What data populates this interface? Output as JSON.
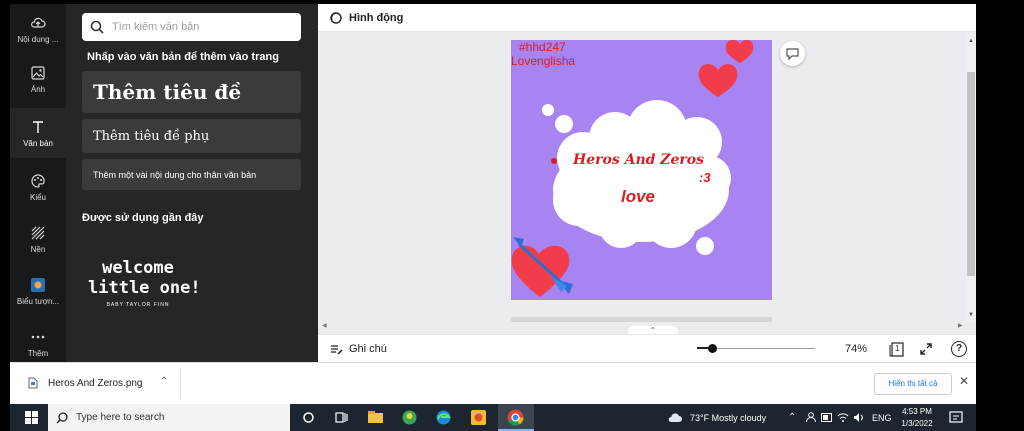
{
  "rail": {
    "items": [
      {
        "label": "Nội dung ...",
        "icon": "upload-cloud-icon"
      },
      {
        "label": "Ảnh",
        "icon": "photo-icon"
      },
      {
        "label": "Văn bản",
        "icon": "text-icon"
      },
      {
        "label": "Kiểu",
        "icon": "palette-icon"
      },
      {
        "label": "Nền",
        "icon": "background-pattern-icon"
      },
      {
        "label": "Biểu tượn...",
        "icon": "logo-icon"
      },
      {
        "label": "Thêm",
        "icon": "more-icon"
      }
    ]
  },
  "panel": {
    "search_placeholder": "Tìm kiếm văn bản",
    "add_text_heading": "Nhấp vào văn bản để thêm vào trang",
    "add_heading": "Thêm tiêu đề",
    "add_subheading": "Thêm tiêu đề phụ",
    "add_body": "Thêm một vài nội dung cho thân văn bản",
    "recent_heading": "Được sử dụng gần đây",
    "recent_item": {
      "line1": "welcome",
      "line2": "little one!",
      "line3": "BABY TAYLOR FINN"
    }
  },
  "topbar": {
    "animate_label": "Hình động"
  },
  "page": {
    "hashtag": "#hhd247",
    "author": "Lovenglisha",
    "title": "Heros And Zeros",
    "emoticon": ":3",
    "love": "love"
  },
  "bottombar": {
    "notes_label": "Ghi chú",
    "zoom": "74%",
    "page_count": "1",
    "zoom_fraction": 0.74
  },
  "download": {
    "filename": "Heros And Zeros.png",
    "show_all": "Hiển thị tất cả"
  },
  "taskbar": {
    "search_placeholder": "Type here to search",
    "weather": "73°F  Mostly cloudy",
    "lang": "ENG",
    "time": "4:53 PM",
    "date": "1/3/2022"
  },
  "colors": {
    "page_bg": "#a883f2",
    "accent_red": "#d81f1f",
    "dark_panel": "#252627"
  }
}
